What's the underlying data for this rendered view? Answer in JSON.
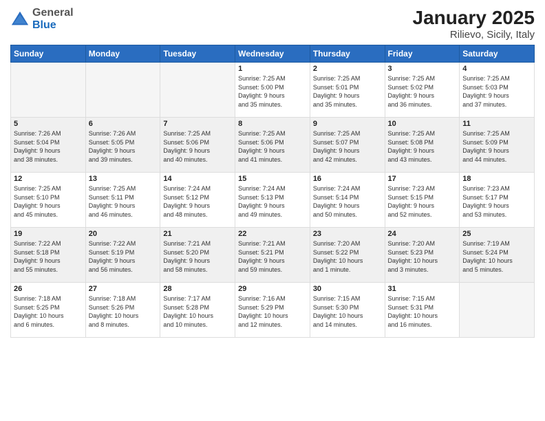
{
  "logo": {
    "general": "General",
    "blue": "Blue"
  },
  "title": "January 2025",
  "subtitle": "Rilievo, Sicily, Italy",
  "weekdays": [
    "Sunday",
    "Monday",
    "Tuesday",
    "Wednesday",
    "Thursday",
    "Friday",
    "Saturday"
  ],
  "weeks": [
    [
      {
        "day": "",
        "info": ""
      },
      {
        "day": "",
        "info": ""
      },
      {
        "day": "",
        "info": ""
      },
      {
        "day": "1",
        "info": "Sunrise: 7:25 AM\nSunset: 5:00 PM\nDaylight: 9 hours\nand 35 minutes."
      },
      {
        "day": "2",
        "info": "Sunrise: 7:25 AM\nSunset: 5:01 PM\nDaylight: 9 hours\nand 35 minutes."
      },
      {
        "day": "3",
        "info": "Sunrise: 7:25 AM\nSunset: 5:02 PM\nDaylight: 9 hours\nand 36 minutes."
      },
      {
        "day": "4",
        "info": "Sunrise: 7:25 AM\nSunset: 5:03 PM\nDaylight: 9 hours\nand 37 minutes."
      }
    ],
    [
      {
        "day": "5",
        "info": "Sunrise: 7:26 AM\nSunset: 5:04 PM\nDaylight: 9 hours\nand 38 minutes."
      },
      {
        "day": "6",
        "info": "Sunrise: 7:26 AM\nSunset: 5:05 PM\nDaylight: 9 hours\nand 39 minutes."
      },
      {
        "day": "7",
        "info": "Sunrise: 7:25 AM\nSunset: 5:06 PM\nDaylight: 9 hours\nand 40 minutes."
      },
      {
        "day": "8",
        "info": "Sunrise: 7:25 AM\nSunset: 5:06 PM\nDaylight: 9 hours\nand 41 minutes."
      },
      {
        "day": "9",
        "info": "Sunrise: 7:25 AM\nSunset: 5:07 PM\nDaylight: 9 hours\nand 42 minutes."
      },
      {
        "day": "10",
        "info": "Sunrise: 7:25 AM\nSunset: 5:08 PM\nDaylight: 9 hours\nand 43 minutes."
      },
      {
        "day": "11",
        "info": "Sunrise: 7:25 AM\nSunset: 5:09 PM\nDaylight: 9 hours\nand 44 minutes."
      }
    ],
    [
      {
        "day": "12",
        "info": "Sunrise: 7:25 AM\nSunset: 5:10 PM\nDaylight: 9 hours\nand 45 minutes."
      },
      {
        "day": "13",
        "info": "Sunrise: 7:25 AM\nSunset: 5:11 PM\nDaylight: 9 hours\nand 46 minutes."
      },
      {
        "day": "14",
        "info": "Sunrise: 7:24 AM\nSunset: 5:12 PM\nDaylight: 9 hours\nand 48 minutes."
      },
      {
        "day": "15",
        "info": "Sunrise: 7:24 AM\nSunset: 5:13 PM\nDaylight: 9 hours\nand 49 minutes."
      },
      {
        "day": "16",
        "info": "Sunrise: 7:24 AM\nSunset: 5:14 PM\nDaylight: 9 hours\nand 50 minutes."
      },
      {
        "day": "17",
        "info": "Sunrise: 7:23 AM\nSunset: 5:15 PM\nDaylight: 9 hours\nand 52 minutes."
      },
      {
        "day": "18",
        "info": "Sunrise: 7:23 AM\nSunset: 5:17 PM\nDaylight: 9 hours\nand 53 minutes."
      }
    ],
    [
      {
        "day": "19",
        "info": "Sunrise: 7:22 AM\nSunset: 5:18 PM\nDaylight: 9 hours\nand 55 minutes."
      },
      {
        "day": "20",
        "info": "Sunrise: 7:22 AM\nSunset: 5:19 PM\nDaylight: 9 hours\nand 56 minutes."
      },
      {
        "day": "21",
        "info": "Sunrise: 7:21 AM\nSunset: 5:20 PM\nDaylight: 9 hours\nand 58 minutes."
      },
      {
        "day": "22",
        "info": "Sunrise: 7:21 AM\nSunset: 5:21 PM\nDaylight: 9 hours\nand 59 minutes."
      },
      {
        "day": "23",
        "info": "Sunrise: 7:20 AM\nSunset: 5:22 PM\nDaylight: 10 hours\nand 1 minute."
      },
      {
        "day": "24",
        "info": "Sunrise: 7:20 AM\nSunset: 5:23 PM\nDaylight: 10 hours\nand 3 minutes."
      },
      {
        "day": "25",
        "info": "Sunrise: 7:19 AM\nSunset: 5:24 PM\nDaylight: 10 hours\nand 5 minutes."
      }
    ],
    [
      {
        "day": "26",
        "info": "Sunrise: 7:18 AM\nSunset: 5:25 PM\nDaylight: 10 hours\nand 6 minutes."
      },
      {
        "day": "27",
        "info": "Sunrise: 7:18 AM\nSunset: 5:26 PM\nDaylight: 10 hours\nand 8 minutes."
      },
      {
        "day": "28",
        "info": "Sunrise: 7:17 AM\nSunset: 5:28 PM\nDaylight: 10 hours\nand 10 minutes."
      },
      {
        "day": "29",
        "info": "Sunrise: 7:16 AM\nSunset: 5:29 PM\nDaylight: 10 hours\nand 12 minutes."
      },
      {
        "day": "30",
        "info": "Sunrise: 7:15 AM\nSunset: 5:30 PM\nDaylight: 10 hours\nand 14 minutes."
      },
      {
        "day": "31",
        "info": "Sunrise: 7:15 AM\nSunset: 5:31 PM\nDaylight: 10 hours\nand 16 minutes."
      },
      {
        "day": "",
        "info": ""
      }
    ]
  ]
}
